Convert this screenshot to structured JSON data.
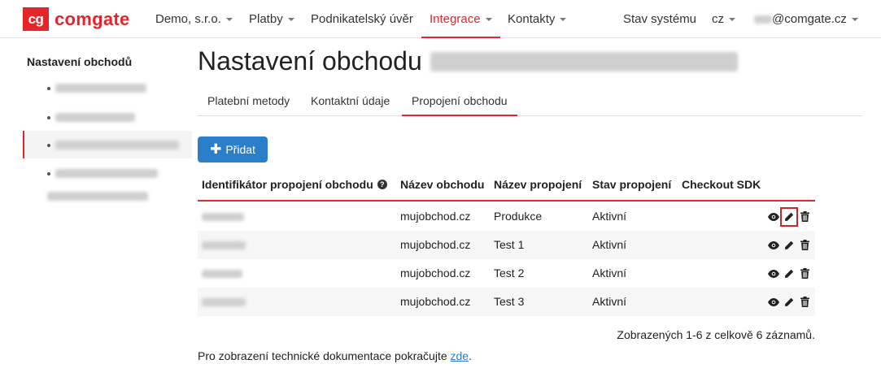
{
  "brand": {
    "logo_mark": "cg",
    "logo_text": "comgate",
    "color": "#e5252a"
  },
  "navbar": {
    "items": [
      {
        "label": "Demo, s.r.o.",
        "dropdown": true
      },
      {
        "label": "Platby",
        "dropdown": true
      },
      {
        "label": "Podnikatelský úvěr",
        "dropdown": false
      },
      {
        "label": "Integrace",
        "dropdown": true,
        "active": true
      },
      {
        "label": "Kontakty",
        "dropdown": true
      }
    ],
    "right": {
      "status": "Stav systému",
      "language": "cz",
      "account_suffix": "@comgate.cz"
    }
  },
  "sidebar": {
    "heading": "Nastavení obchodů"
  },
  "main": {
    "title": "Nastavení obchodu",
    "tabs": [
      {
        "label": "Platební metody"
      },
      {
        "label": "Kontaktní údaje"
      },
      {
        "label": "Propojení obchodu",
        "active": true
      }
    ],
    "add_button": {
      "icon": "plus-icon",
      "label": "Přidat"
    },
    "table": {
      "columns": [
        "Identifikátor propojení obchodu",
        "Název obchodu",
        "Název propojení",
        "Stav propojení",
        "Checkout SDK"
      ],
      "rows": [
        {
          "shop": "mujobchod.cz",
          "connection": "Produkce",
          "status": "Aktivní"
        },
        {
          "shop": "mujobchod.cz",
          "connection": "Test 1",
          "status": "Aktivní"
        },
        {
          "shop": "mujobchod.cz",
          "connection": "Test 2",
          "status": "Aktivní"
        },
        {
          "shop": "mujobchod.cz",
          "connection": "Test 3",
          "status": "Aktivní"
        }
      ],
      "row_actions": [
        "eye-icon",
        "pencil-icon",
        "trash-icon"
      ]
    },
    "count_text": "Zobrazených 1-6 z celkově 6 záznamů.",
    "doc_note": {
      "text": "Pro zobrazení technické dokumentace pokračujte ",
      "link": "zde",
      "suffix": "."
    }
  },
  "colors": {
    "accent": "#e5252a",
    "button": "#2b7ec9",
    "highlight": "#d3212a"
  }
}
